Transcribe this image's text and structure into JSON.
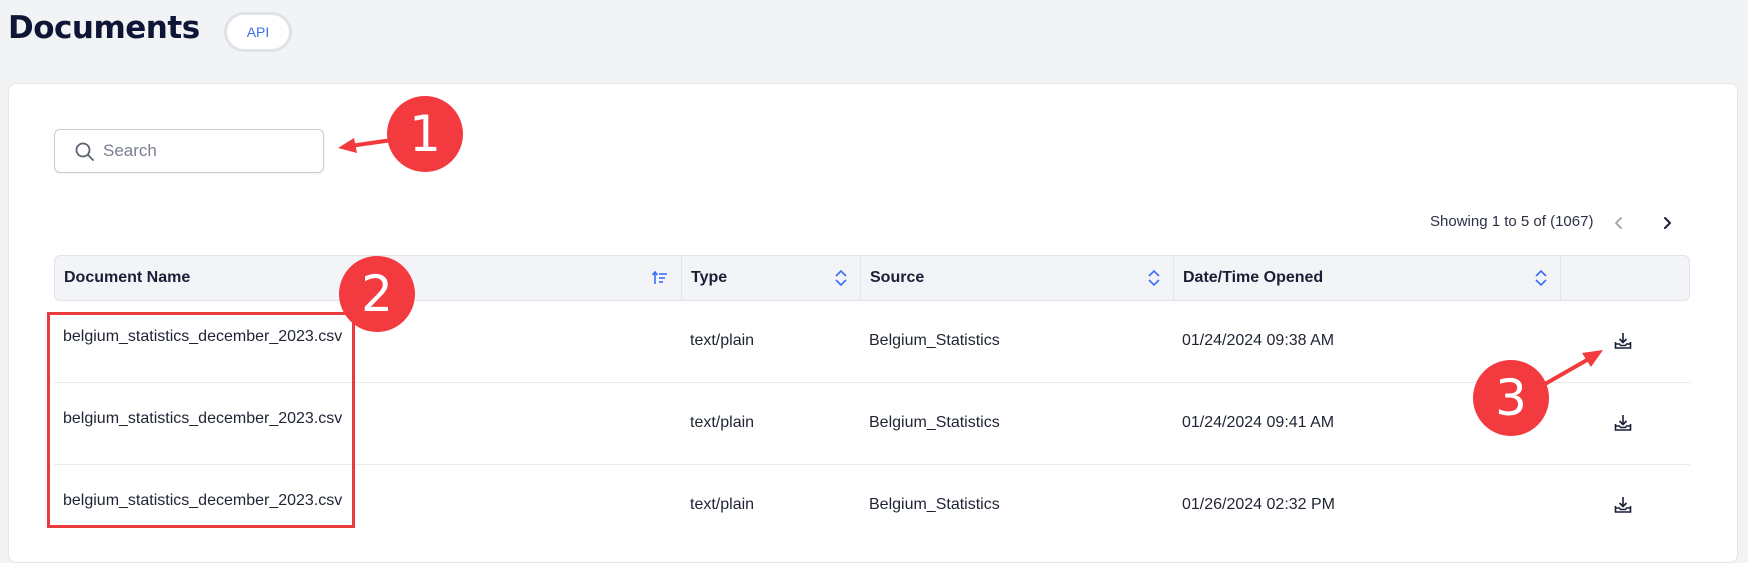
{
  "header": {
    "title": "Documents",
    "api_label": "API"
  },
  "search": {
    "placeholder": "Search",
    "value": ""
  },
  "pagination": {
    "showing_text": "Showing 1 to 5 of (1067)"
  },
  "table": {
    "columns": [
      "Document Name",
      "Type",
      "Source",
      "Date/Time Opened"
    ],
    "rows": [
      {
        "name": "belgium_statistics_december_2023.csv",
        "type": "text/plain",
        "source": "Belgium_Statistics",
        "opened": "01/24/2024 09:38 AM"
      },
      {
        "name": "belgium_statistics_december_2023.csv",
        "type": "text/plain",
        "source": "Belgium_Statistics",
        "opened": "01/24/2024 09:41 AM"
      },
      {
        "name": "belgium_statistics_december_2023.csv",
        "type": "text/plain",
        "source": "Belgium_Statistics",
        "opened": "01/26/2024 02:32 PM"
      }
    ]
  },
  "annotations": {
    "marker_1": "1",
    "marker_2": "2",
    "marker_3": "3"
  },
  "colors": {
    "accent": "#3b6ef5",
    "annotation": "#f23a3f",
    "title": "#0f1535"
  },
  "icons": [
    "search-icon",
    "sort-ascending-icon",
    "sort-icon",
    "chevron-left-icon",
    "chevron-right-icon",
    "download-icon"
  ]
}
